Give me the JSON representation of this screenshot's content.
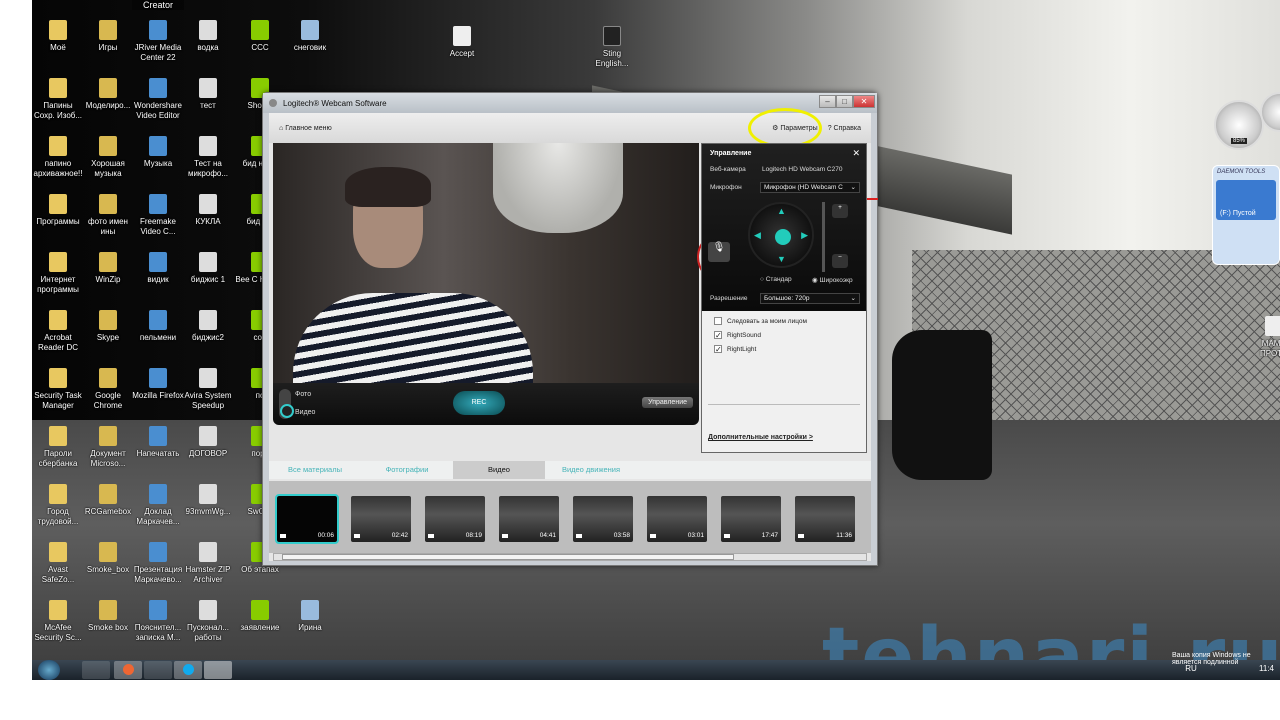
{
  "desktop": {
    "top_label": "Creator",
    "columns": [
      [
        "Моё",
        "Папины Сохр. Изоб...",
        "папино архиважное!!",
        "Программы",
        "Интернет программы",
        "Acrobat Reader DC",
        "Security Task Manager",
        "Пароли сбербанка",
        "Город трудовой...",
        "Avast SafeZo...",
        "McAfee Security Sc..."
      ],
      [
        "Игры",
        "Моделиро...",
        "Хорошая музыка",
        "фото имен ины",
        "WinZip",
        "Skype",
        "Google Chrome",
        "Документ Microso...",
        "RCGamebox",
        "Smoke_box",
        "Smoke box"
      ],
      [
        "JRiver Media Center 22",
        "Wondershare Video Editor",
        "Музыка",
        "Freemake Video C...",
        "видик",
        "пельмени",
        "Mozilla Firefox",
        "Напечатать",
        "Доклад Маркачев...",
        "Презентация Маркачево...",
        "Пояснител... записка М..."
      ],
      [
        "водка",
        "тест",
        "Тест на микрофо...",
        "КУКЛА",
        "биджис 1",
        "биджис2",
        "Avira System Speedup",
        "ДОГОВОР",
        "93mvmWg...",
        "Hamster ZIP Archiver",
        "Пусконал... работы"
      ],
      [
        "CCC",
        "Shost_",
        "бид норм",
        "бид фо",
        "Bee C How to",
        "соб",
        "по",
        "порс",
        "SwCAr",
        "Об этапах",
        "заявление"
      ],
      [
        "снеговик",
        "",
        "",
        "",
        "",
        "",
        "",
        "",
        "",
        "",
        "Ирина"
      ]
    ],
    "extra_icons": [
      "Accept",
      "Sting English...",
      "МАМИ ПРОТО"
    ]
  },
  "window": {
    "title": "Logitech® Webcam Software",
    "home": "Главное меню",
    "settings": "Параметры",
    "help": "Справка",
    "mode_photo": "Фото",
    "mode_video": "Видео",
    "record_label": "REC",
    "controls_button": "Управление",
    "panel": {
      "title": "Управление",
      "webcam_label": "Веб-камера",
      "webcam_value": "Logitech HD Webcam C270",
      "mic_label": "Микрофон",
      "mic_value": "Микрофон (HD Webcam C",
      "standard": "Стандар",
      "wide": "Широкоэкр",
      "resolution_label": "Разрешение",
      "resolution_value": "Большое: 720p",
      "checks": [
        {
          "label": "Следовать за моим лицом",
          "checked": false
        },
        {
          "label": "RightSound",
          "checked": true
        },
        {
          "label": "RightLight",
          "checked": true
        }
      ],
      "advanced": "Дополнительные настройки >"
    },
    "tabs": [
      {
        "label": "Все материалы",
        "active": false
      },
      {
        "label": "Фотографии",
        "active": false
      },
      {
        "label": "Видео",
        "active": true
      },
      {
        "label": "Видео движения",
        "active": false
      }
    ],
    "thumbnails": [
      "00:06",
      "02:42",
      "08:19",
      "04:41",
      "03:58",
      "03:01",
      "17:47",
      "11:36"
    ]
  },
  "gadget": {
    "brand": "DAEMON TOOLS",
    "drive": "(F:) Пустой",
    "cpu": "85%"
  },
  "tray": {
    "lang": "RU",
    "time": "11:4",
    "activation": "Ваша копия Windows не является подлинной"
  },
  "watermark": "tehnari.ru",
  "colors": {
    "accent": "#2cbcbc",
    "highlight": "#f0f000",
    "annotation": "#cc2222"
  }
}
